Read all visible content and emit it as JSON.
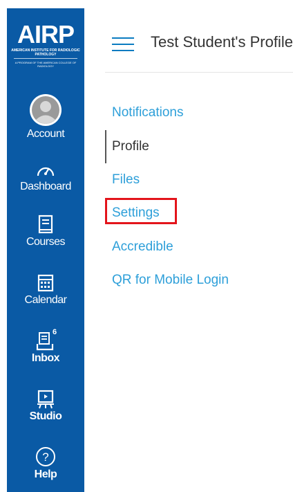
{
  "brand": {
    "logo_text": "AIRP",
    "logo_subtitle": "AMERICAN INSTITUTE FOR RADIOLOGIC PATHOLOGY",
    "logo_subtitle2": "A PROGRAM OF THE AMERICAN COLLEGE OF RADIOLOGY"
  },
  "sidebar": {
    "items": [
      {
        "label": "Account",
        "icon": "avatar-icon"
      },
      {
        "label": "Dashboard",
        "icon": "dashboard-icon"
      },
      {
        "label": "Courses",
        "icon": "courses-icon"
      },
      {
        "label": "Calendar",
        "icon": "calendar-icon"
      },
      {
        "label": "Inbox",
        "icon": "inbox-icon",
        "badge": "6"
      },
      {
        "label": "Studio",
        "icon": "studio-icon"
      },
      {
        "label": "Help",
        "icon": "help-icon"
      }
    ]
  },
  "header": {
    "title": "Test Student's Profile"
  },
  "subnav": {
    "items": [
      {
        "label": "Notifications"
      },
      {
        "label": "Profile"
      },
      {
        "label": "Files"
      },
      {
        "label": "Settings"
      },
      {
        "label": "Accredible"
      },
      {
        "label": "QR for Mobile Login"
      }
    ],
    "active_index": 1,
    "highlighted_index": 3
  },
  "colors": {
    "sidebar": "#0a5aa5",
    "link": "#2d9fd9",
    "highlight": "#e3141b"
  }
}
